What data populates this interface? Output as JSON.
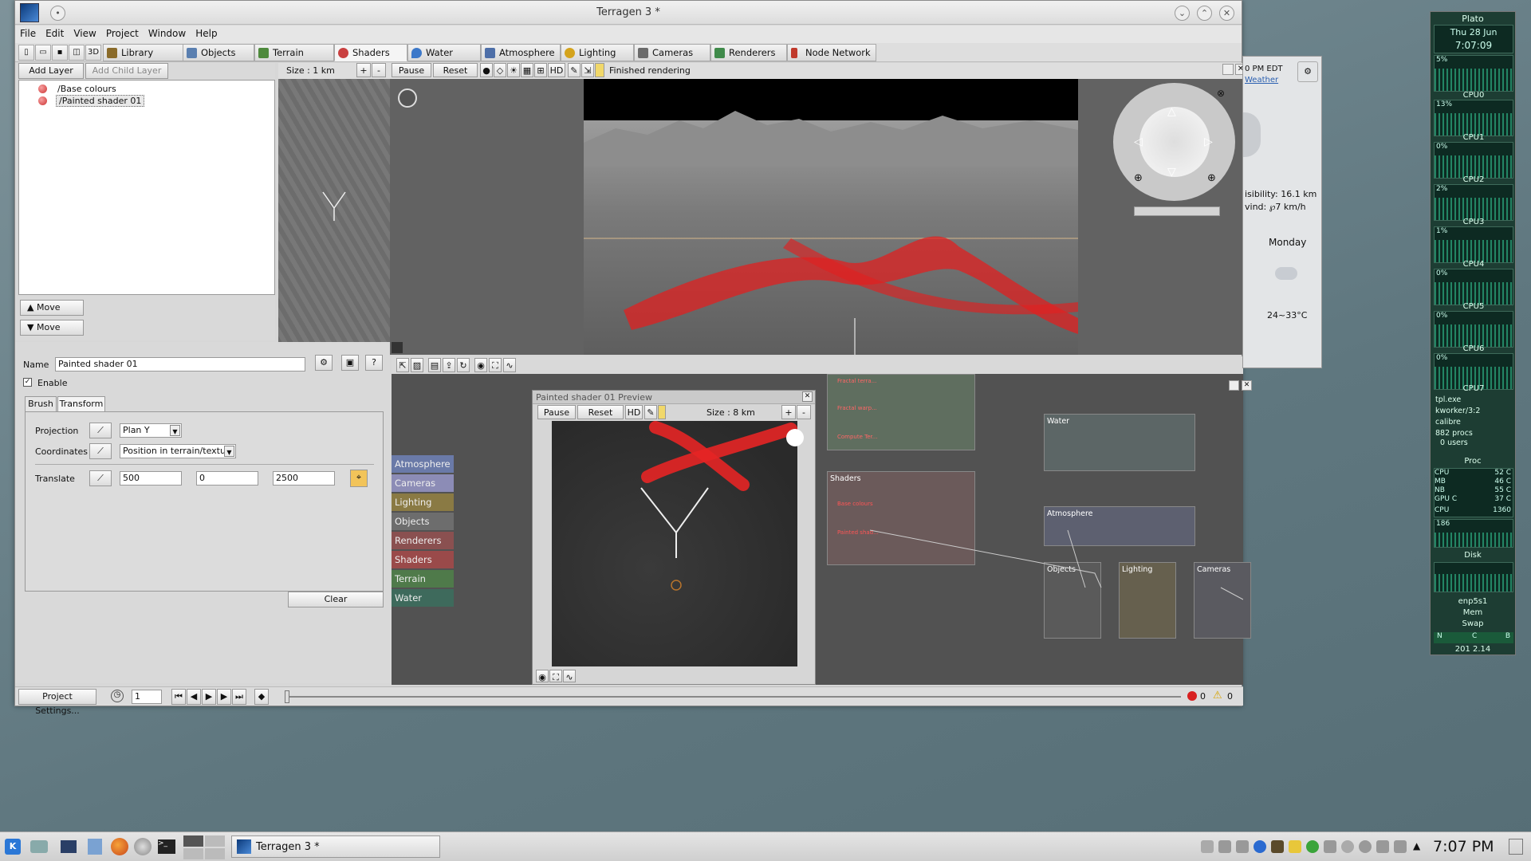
{
  "window": {
    "title": "Terragen 3 *"
  },
  "menus": [
    "File",
    "Edit",
    "View",
    "Project",
    "Window",
    "Help"
  ],
  "tabs": [
    {
      "label": "Library",
      "color": "#8a6b2a"
    },
    {
      "label": "Objects",
      "color": "#5a7fb0"
    },
    {
      "label": "Terrain",
      "color": "#4e8a3c"
    },
    {
      "label": "Shaders",
      "color": "#c94040"
    },
    {
      "label": "Water",
      "color": "#3b78c9"
    },
    {
      "label": "Atmosphere",
      "color": "#4e6fa8"
    },
    {
      "label": "Lighting",
      "color": "#d4a31c"
    },
    {
      "label": "Cameras",
      "color": "#6b6b6b"
    },
    {
      "label": "Renderers",
      "color": "#3f8a4a"
    },
    {
      "label": "Node Network",
      "color": "#c0392b"
    }
  ],
  "layers": {
    "add_label": "Add Layer",
    "add_child_label": "Add Child Layer",
    "items": [
      "/Base colours",
      "/Painted shader 01"
    ],
    "move_up": "Move",
    "move_down": "Move"
  },
  "viewport": {
    "size_label": "Size : 1 km",
    "plus": "+",
    "minus": "-",
    "pause": "Pause",
    "reset": "Reset",
    "hd": "HD",
    "status": "Finished rendering"
  },
  "props": {
    "name_label": "Name",
    "name_value": "Painted shader 01",
    "enable_label": "Enable",
    "tab_brush": "Brush",
    "tab_transform": "Transform",
    "projection_label": "Projection",
    "projection_value": "Plan Y",
    "coordinates_label": "Coordinates",
    "coordinates_value": "Position in terrain/texture",
    "translate_label": "Translate",
    "tx": "500",
    "ty": "0",
    "tz": "2500",
    "clear": "Clear"
  },
  "network": {
    "categories": [
      {
        "label": "Atmosphere",
        "color": "#6a7aa8"
      },
      {
        "label": "Cameras",
        "color": "#8c8cb6"
      },
      {
        "label": "Lighting",
        "color": "#8a7a44"
      },
      {
        "label": "Objects",
        "color": "#6d6d6d"
      },
      {
        "label": "Renderers",
        "color": "#8a5050"
      },
      {
        "label": "Shaders",
        "color": "#9a4a4a"
      },
      {
        "label": "Terrain",
        "color": "#4f7a4a"
      },
      {
        "label": "Water",
        "color": "#3e6a5c"
      }
    ],
    "node_water": "Water",
    "node_shaders": "Shaders",
    "node_atmosphere": "Atmosphere",
    "node_objects": "Objects",
    "node_lighting": "Lighting",
    "node_cameras": "Cameras",
    "terrain_nodes": [
      "Fractal terra...",
      "Fractal warp...",
      "Compute Ter..."
    ],
    "shader_nodes": [
      "Base colours",
      "Painted shad..."
    ]
  },
  "preview": {
    "title": "Painted shader 01 Preview",
    "pause": "Pause",
    "reset": "Reset",
    "hd": "HD",
    "size_label": "Size : 8 km",
    "plus": "+",
    "minus": "-"
  },
  "bottom": {
    "project_settings": "Project Settings...",
    "frame": "1",
    "errors": "0",
    "warnings": "0"
  },
  "weather": {
    "time": "0 PM EDT",
    "link": "Weather",
    "visibility": "isibility: 16.1 km",
    "wind": "vind: ℘7 km/h",
    "day": "Monday",
    "temp": "24~33°C"
  },
  "sysmon": {
    "host": "Plato",
    "date": "Thu 28 Jun",
    "clock": "7:07:09",
    "cpu_labels": [
      "CPU0",
      "CPU1",
      "CPU2",
      "CPU3",
      "CPU4",
      "CPU5",
      "CPU6",
      "CPU7"
    ],
    "cpu_pcts": [
      "5%",
      "13%",
      "0%",
      "2%",
      "1%",
      "0%",
      "0%",
      "0%"
    ],
    "procs": [
      "tpl.exe",
      "kworker/3:2",
      "calibre",
      "882 procs",
      "0 users"
    ],
    "proc_label": "Proc",
    "temps": [
      [
        "CPU",
        "52 C"
      ],
      [
        "MB",
        "46 C"
      ],
      [
        "NB",
        "55 C"
      ],
      [
        "GPU C",
        "37 C"
      ]
    ],
    "fan": [
      "CPU",
      "1360"
    ],
    "disk_label": "Disk",
    "disk_val": "186",
    "net_label": "enp5s1",
    "mem_label": "Mem",
    "swap_label": "Swap",
    "nbar": [
      "N",
      "C",
      "B"
    ],
    "bottom": "201 2.14"
  },
  "taskbar": {
    "task": "Terragen 3 *",
    "clock": "7:07 PM"
  }
}
